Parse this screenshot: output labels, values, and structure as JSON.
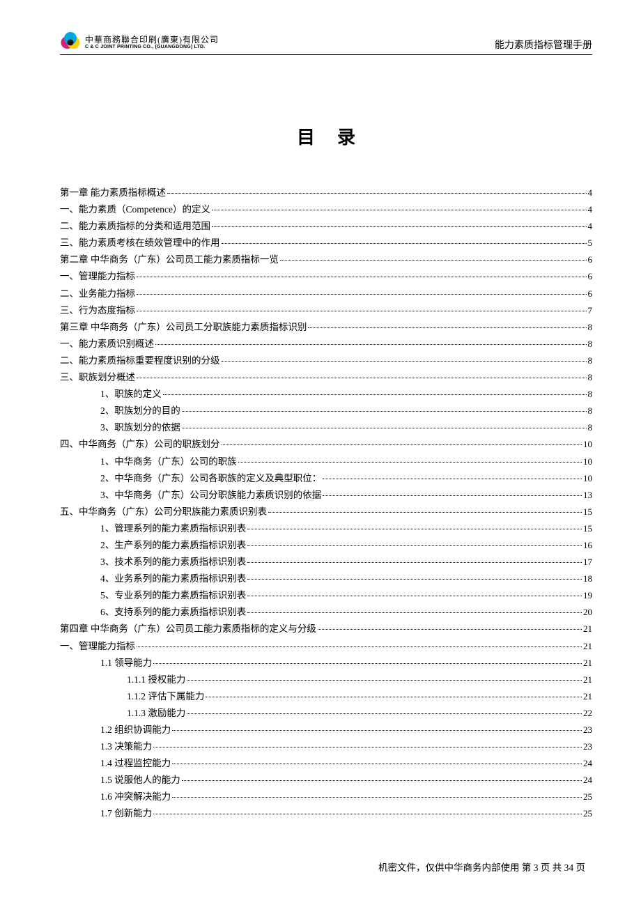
{
  "header": {
    "logo_cn": "中華商務聯合印刷(廣東)有限公司",
    "logo_en": "C & C JOINT PRINTING CO., (GUANGDONG) LTD.",
    "doc_title": "能力素质指标管理手册"
  },
  "toc_title": "目录",
  "toc": [
    {
      "level": 0,
      "label": "第一章 能力素质指标概述",
      "page": "4"
    },
    {
      "level": 0,
      "label": "一、能力素质（Competence）的定义",
      "page": "4"
    },
    {
      "level": 0,
      "label": "二、能力素质指标的分类和适用范围",
      "page": "4"
    },
    {
      "level": 0,
      "label": "三、能力素质考核在绩效管理中的作用",
      "page": "5"
    },
    {
      "level": 0,
      "label": "第二章 中华商务（广东）公司员工能力素质指标一览",
      "page": "6"
    },
    {
      "level": 0,
      "label": "一、管理能力指标",
      "page": "6"
    },
    {
      "level": 0,
      "label": "二、业务能力指标",
      "page": "6"
    },
    {
      "level": 0,
      "label": "三、行为态度指标",
      "page": "7"
    },
    {
      "level": 0,
      "label": "第三章 中华商务（广东）公司员工分职族能力素质指标识别",
      "page": "8"
    },
    {
      "level": 0,
      "label": "一、能力素质识别概述",
      "page": "8"
    },
    {
      "level": 0,
      "label": "二、能力素质指标重要程度识别的分级",
      "page": "8"
    },
    {
      "level": 0,
      "label": "三、职族划分概述",
      "page": "8"
    },
    {
      "level": 1,
      "label": "1、职族的定义",
      "page": "8"
    },
    {
      "level": 1,
      "label": "2、职族划分的目的",
      "page": "8"
    },
    {
      "level": 1,
      "label": "3、职族划分的依据",
      "page": "8"
    },
    {
      "level": 0,
      "label": "四、中华商务（广东）公司的职族划分",
      "page": "10"
    },
    {
      "level": 1,
      "label": "1、中华商务（广东）公司的职族",
      "page": "10"
    },
    {
      "level": 1,
      "label": "2、中华商务（广东）公司各职族的定义及典型职位：",
      "page": "10"
    },
    {
      "level": 1,
      "label": "3、中华商务（广东）公司分职族能力素质识别的依据",
      "page": "13"
    },
    {
      "level": 0,
      "label": "五、中华商务（广东）公司分职族能力素质识别表",
      "page": "15"
    },
    {
      "level": 1,
      "label": "1、管理系列的能力素质指标识别表",
      "page": "15"
    },
    {
      "level": 1,
      "label": "2、生产系列的能力素质指标识别表",
      "page": "16"
    },
    {
      "level": 1,
      "label": "3、技术系列的能力素质指标识别表",
      "page": "17"
    },
    {
      "level": 1,
      "label": "4、业务系列的能力素质指标识别表",
      "page": "18"
    },
    {
      "level": 1,
      "label": "5、专业系列的能力素质指标识别表",
      "page": "19"
    },
    {
      "level": 1,
      "label": "6、支持系列的能力素质指标识别表",
      "page": "20"
    },
    {
      "level": 0,
      "label": "第四章 中华商务（广东）公司员工能力素质指标的定义与分级",
      "page": "21"
    },
    {
      "level": 0,
      "label": "一、管理能力指标",
      "page": "21"
    },
    {
      "level": 1,
      "label": "1.1 领导能力",
      "page": "21"
    },
    {
      "level": 2,
      "label": "1.1.1 授权能力",
      "page": "21"
    },
    {
      "level": 2,
      "label": "1.1.2 评估下属能力",
      "page": "21"
    },
    {
      "level": 2,
      "label": "1.1.3 激励能力",
      "page": "22"
    },
    {
      "level": 1,
      "label": "1.2 组织协调能力",
      "page": "23"
    },
    {
      "level": 1,
      "label": "1.3 决策能力",
      "page": "23"
    },
    {
      "level": 1,
      "label": "1.4 过程监控能力",
      "page": "24"
    },
    {
      "level": 1,
      "label": "1.5 说服他人的能力",
      "page": "24"
    },
    {
      "level": 1,
      "label": "1.6 冲突解决能力",
      "page": "25"
    },
    {
      "level": 1,
      "label": "1.7 创新能力",
      "page": "25"
    }
  ],
  "footer": {
    "prefix": "机密文件，仅供中华商务内部使用 第 ",
    "current": "3",
    "mid": " 页 共 ",
    "total": "34",
    "suffix": " 页"
  }
}
